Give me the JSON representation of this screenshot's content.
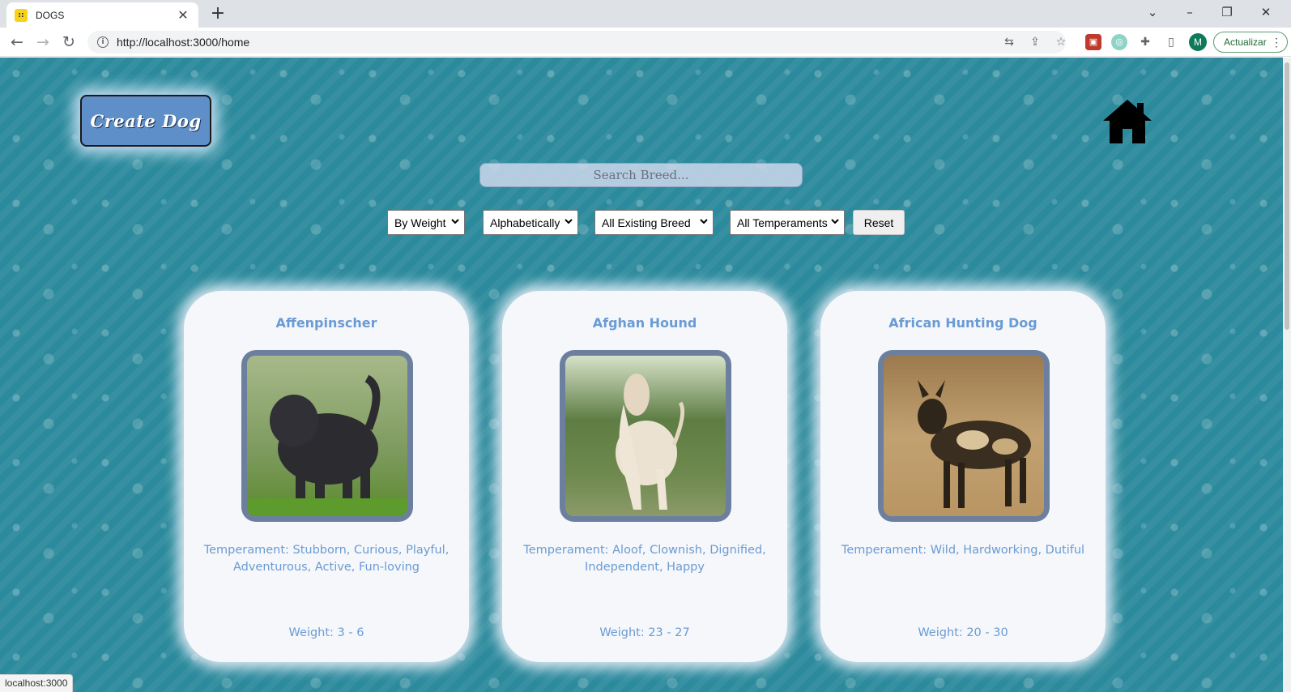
{
  "browser": {
    "tab_title": "DOGS",
    "favicon_text": "::",
    "url": "http://localhost:3000/home",
    "update_label": "Actualizar",
    "avatar_letter": "M",
    "status_text": "localhost:3000"
  },
  "header": {
    "create_label": "Create Dog",
    "search_placeholder": "Search Breed..."
  },
  "filters": {
    "weight": "By Weight",
    "alphabetical": "Alphabetically",
    "breed": "All Existing Breed",
    "temperament": "All Temperaments",
    "reset_label": "Reset"
  },
  "cards": [
    {
      "name": "Affenpinscher",
      "temperament": "Temperament: Stubborn, Curious, Playful, Adventurous, Active, Fun-loving",
      "weight": "Weight: 3 - 6",
      "photo_colors": [
        "#7a8f6a",
        "#2c2c30"
      ]
    },
    {
      "name": "Afghan Hound",
      "temperament": "Temperament: Aloof, Clownish, Dignified, Independent, Happy",
      "weight": "Weight: 23 - 27",
      "photo_colors": [
        "#4f6b3e",
        "#e8dccb"
      ]
    },
    {
      "name": "African Hunting Dog",
      "temperament": "Temperament: Wild, Hardworking, Dutiful",
      "weight": "Weight: 20 - 30",
      "photo_colors": [
        "#b59462",
        "#3a2e20"
      ]
    }
  ]
}
